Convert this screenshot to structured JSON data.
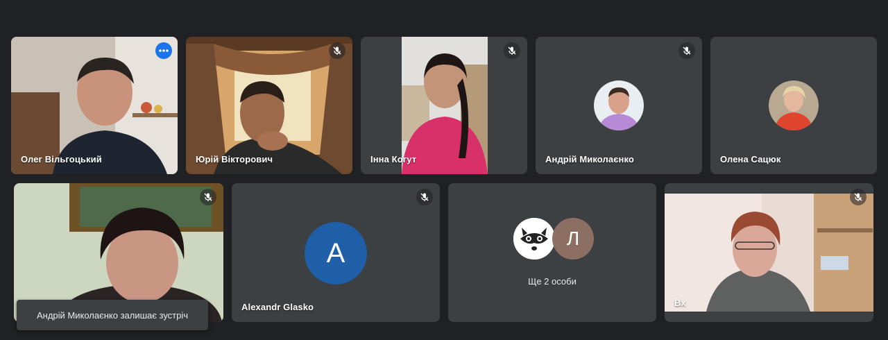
{
  "participants": [
    {
      "name": "Олег Вільгоцький",
      "muted": false,
      "active": true
    },
    {
      "name": "Юрій Вікторович",
      "muted": true
    },
    {
      "name": "Інна Когут",
      "muted": true
    },
    {
      "name": "Андрій Миколаєнко",
      "muted": true
    },
    {
      "name": "Олена Сацюк",
      "muted": true
    },
    {
      "name": "",
      "muted": true
    },
    {
      "name": "Alexandr Glasko",
      "muted": true,
      "avatar_letter": "A",
      "avatar_color": "#1e5fa8"
    },
    {
      "name": "",
      "muted": true
    },
    {
      "name": "Вх",
      "muted": true
    }
  ],
  "more_tile": {
    "label": "Ще 2 особи",
    "letter": "Л",
    "letter_color": "#8d6e63"
  },
  "toast": {
    "text": "Андрій Миколаєнко залишає зустріч"
  },
  "icons": {
    "mic_off": "mic-off-icon",
    "more_options": "more-options-icon"
  }
}
